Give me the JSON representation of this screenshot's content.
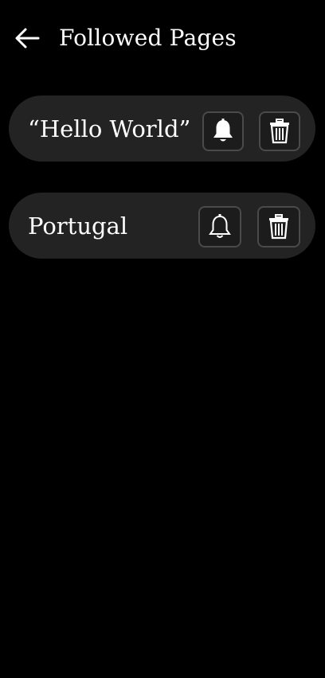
{
  "header": {
    "title": "Followed Pages",
    "back_icon": "arrow-left-icon"
  },
  "followed_pages": [
    {
      "label": "“Hello World”",
      "notifications": "on",
      "bell_icon": "bell-filled-icon",
      "delete_icon": "trash-icon"
    },
    {
      "label": "Portugal",
      "notifications": "off",
      "bell_icon": "bell-outline-icon",
      "delete_icon": "trash-icon"
    }
  ],
  "colors": {
    "background": "#000000",
    "card": "#232323",
    "text": "#ffffff",
    "button_border": "#4a4a4a"
  }
}
